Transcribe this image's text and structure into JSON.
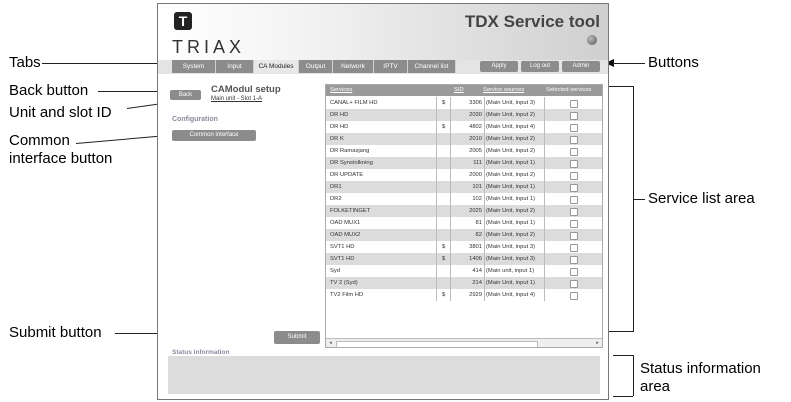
{
  "callouts": {
    "tabs": "Tabs",
    "back_button": "Back button",
    "unit_slot": "Unit and slot ID",
    "common_interface_1": "Common",
    "common_interface_2": "interface button",
    "submit_button": "Submit button",
    "buttons": "Buttons",
    "service_list_area": "Service list area",
    "status_info_1": "Status information",
    "status_info_2": "area"
  },
  "app": {
    "logo_letter": "T",
    "brand": "TRIAX",
    "title": "TDX Service tool",
    "tabs": [
      {
        "label": "System",
        "active": false
      },
      {
        "label": "Input",
        "active": false
      },
      {
        "label": "CA Modules",
        "active": true
      },
      {
        "label": "Output",
        "active": false
      },
      {
        "label": "Network",
        "active": false
      },
      {
        "label": "IPTV",
        "active": false
      },
      {
        "label": "Channel list",
        "active": false
      }
    ],
    "buttons": {
      "apply": "Apply",
      "logout": "Log out",
      "admin": "Admin"
    },
    "back_label": "Back",
    "page_title": "CAModul setup",
    "slot_id": "Main unit - Slot 1-A",
    "config_heading": "Configuration",
    "ci_button": "Common interface",
    "submit_label": "Submit",
    "status_heading": "Status information"
  },
  "service_list": {
    "headers": {
      "services": "Services",
      "sid": "SID",
      "sources": "Service sources",
      "selected": "Selected services"
    },
    "rows": [
      {
        "name": "CANAL+ FILM HD",
        "scrambled": "$",
        "sid": "3306",
        "source": "(Main Unit, input 3)"
      },
      {
        "name": "DR HD",
        "scrambled": "",
        "sid": "2030",
        "source": "(Main Unit, input 2)"
      },
      {
        "name": "DR HD",
        "scrambled": "$",
        "sid": "4802",
        "source": "(Main Unit, input 4)"
      },
      {
        "name": "DR K",
        "scrambled": "",
        "sid": "2010",
        "source": "(Main Unit, input 2)"
      },
      {
        "name": "DR Ramasjang",
        "scrambled": "",
        "sid": "2005",
        "source": "(Main Unit, input 2)"
      },
      {
        "name": "DR Synstolkning",
        "scrambled": "",
        "sid": "111",
        "source": "(Main Unit, input 1)"
      },
      {
        "name": "DR UPDATE",
        "scrambled": "",
        "sid": "2000",
        "source": "(Main Unit, input 2)"
      },
      {
        "name": "DR1",
        "scrambled": "",
        "sid": "101",
        "source": "(Main Unit, input 1)"
      },
      {
        "name": "DR2",
        "scrambled": "",
        "sid": "102",
        "source": "(Main Unit, input 1)"
      },
      {
        "name": "FOLKETINGET",
        "scrambled": "",
        "sid": "2025",
        "source": "(Main Unit, input 2)"
      },
      {
        "name": "OAD MUX1",
        "scrambled": "",
        "sid": "81",
        "source": "(Main Unit, input 1)"
      },
      {
        "name": "OAD MUX2",
        "scrambled": "",
        "sid": "82",
        "source": "(Main Unit, input 2)"
      },
      {
        "name": "SVT1 HD",
        "scrambled": "$",
        "sid": "3801",
        "source": "(Main Unit, input 3)"
      },
      {
        "name": "SVT1 HD",
        "scrambled": "$",
        "sid": "1406",
        "source": "(Main Unit, input 3)"
      },
      {
        "name": "Syd",
        "scrambled": "",
        "sid": "414",
        "source": "(Main unit, input 1)"
      },
      {
        "name": "TV 2 (Syd)",
        "scrambled": "",
        "sid": "214",
        "source": "(Main Unit, input 1)"
      },
      {
        "name": "TV2 Film HD",
        "scrambled": "$",
        "sid": "2929",
        "source": "(Main Unit, input 4)"
      }
    ],
    "scroll_left": "◂",
    "scroll_right": "▸"
  }
}
